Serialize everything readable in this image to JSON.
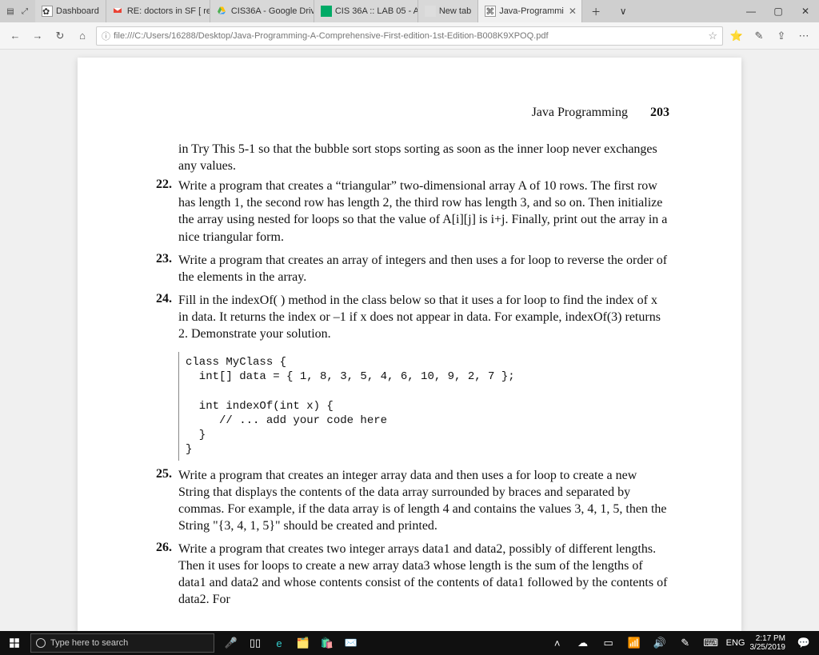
{
  "browser": {
    "tabs": [
      {
        "label": "Dashboard"
      },
      {
        "label": "RE: doctors in SF [ re"
      },
      {
        "label": "CIS36A - Google Driv"
      },
      {
        "label": "CIS 36A :: LAB 05 - A"
      },
      {
        "label": "New tab"
      },
      {
        "label": "Java-Programmi"
      }
    ],
    "address": "file:///C:/Users/16288/Desktop/Java-Programming-A-Comprehensive-First-edition-1st-Edition-B008K9XPOQ.pdf"
  },
  "doc": {
    "running_title": "Java Programming",
    "page_number": "203",
    "intro": "in Try This 5-1 so that the bubble sort stops sorting as soon as the inner loop never exchanges any values.",
    "items": {
      "22": "Write a program that creates a “triangular” two-dimensional array A of 10 rows. The first row has length 1, the second row has length 2, the third row has length 3, and so on. Then initialize the array using nested for loops so that the value of A[i][j] is i+j. Finally, print out the array in a nice triangular form.",
      "23": "Write a program that creates an array of integers and then uses a for loop to reverse the order of the elements in the array.",
      "24": "Fill in the indexOf( ) method in the class below so that it uses a for loop to find the index of x  in data.  It returns the index or –1 if x does not appear in data. For example, indexOf(3) returns 2. Demonstrate your solution.",
      "25": "Write a program that creates an integer array data and then uses a for loop to create a new String that displays the contents of the data array surrounded by braces and separated by commas. For example, if the data array is of length 4 and contains the values 3, 4, 1, 5, then the String \"{3, 4, 1, 5}\" should be created and printed.",
      "26": "Write a program that creates two integer arrays data1 and data2, possibly of different lengths.  Then it uses for loops to create a new array data3 whose length is the sum of the lengths of data1 and data2 and whose contents consist of the contents of data1 followed by the contents of data2. For"
    },
    "code": "class MyClass {\n  int[] data = { 1, 8, 3, 5, 4, 6, 10, 9, 2, 7 };\n\n  int indexOf(int x) {\n     // ... add your code here\n  }\n}"
  },
  "taskbar": {
    "search_placeholder": "Type here to search",
    "lang": "ENG",
    "time": "2:17 PM",
    "date": "3/25/2019"
  }
}
